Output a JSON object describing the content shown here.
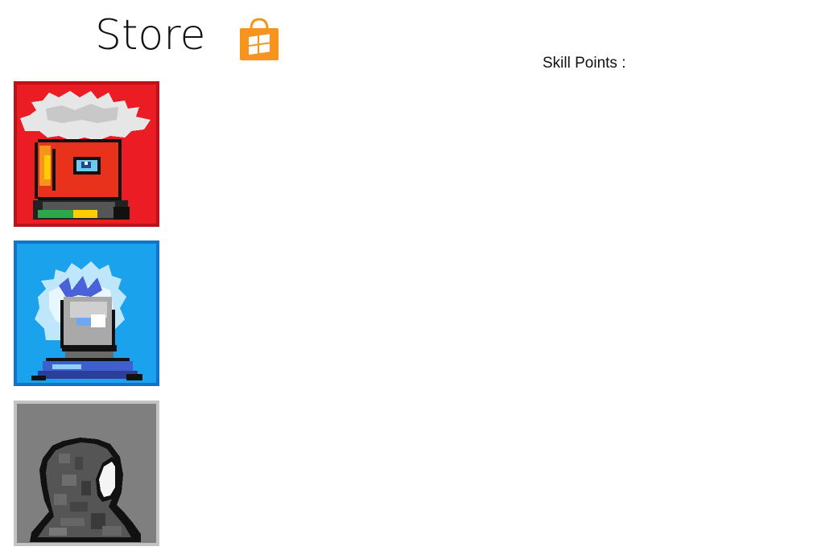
{
  "header": {
    "title": "Store",
    "store_icon": "windows-store-bag-icon",
    "skill_points_label": "Skill Points :"
  },
  "store_items": [
    {
      "id": "fire",
      "icon": "fire-character-portrait",
      "accent": "#ec1c24",
      "border": "#b8141a"
    },
    {
      "id": "ice",
      "icon": "ice-character-portrait",
      "accent": "#1aa3ec",
      "border": "#1273c9"
    },
    {
      "id": "shadow",
      "icon": "shadow-character-portrait",
      "accent": "#7f7f7f",
      "border": "#c3c3c3"
    }
  ],
  "colors": {
    "background": "#ffffff",
    "store_icon_orange": "#f7941d"
  }
}
